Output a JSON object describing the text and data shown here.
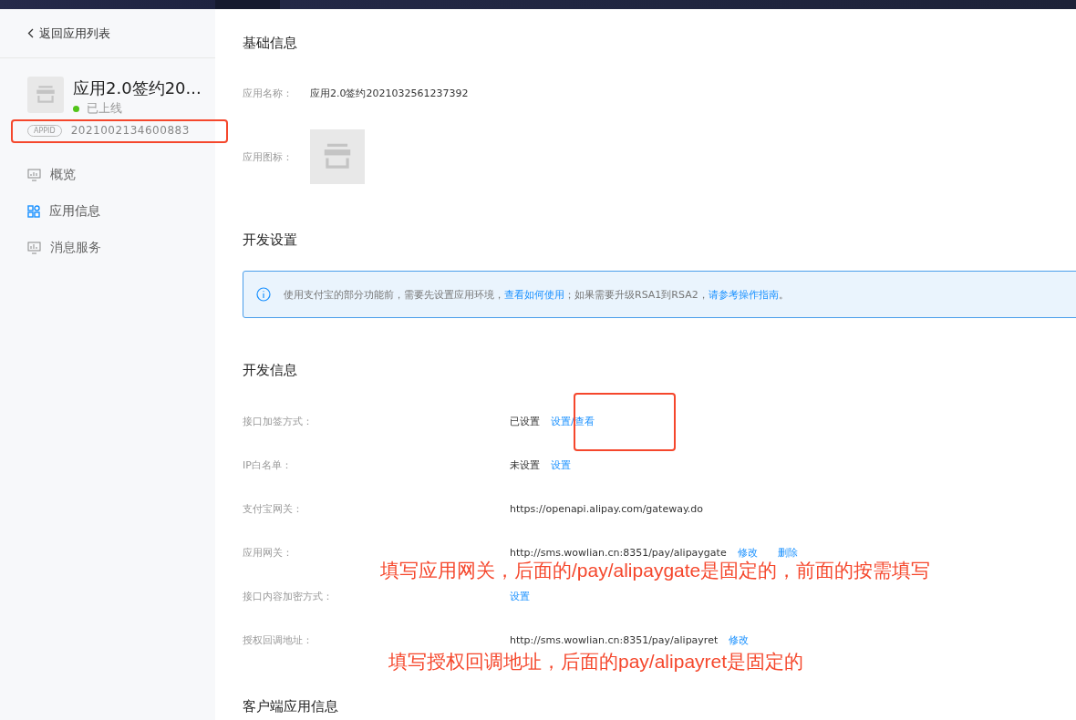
{
  "sidebar": {
    "back_link": "返回应用列表",
    "app": {
      "name": "应用2.0签约20...",
      "status": "已上线",
      "color": "#52c41a",
      "appid_tag": "APPID",
      "appid": "2021002134600883"
    },
    "items": [
      {
        "label": "概览",
        "selected": false,
        "kind": "monitor"
      },
      {
        "label": "应用信息",
        "selected": true,
        "kind": "grid"
      },
      {
        "label": "消息服务",
        "selected": false,
        "kind": "chart"
      }
    ]
  },
  "basic_info": {
    "title": "基础信息",
    "name_label": "应用名称：",
    "name_value": "应用2.0签约2021032561237392",
    "icon_label": "应用图标："
  },
  "dev_settings": {
    "title": "开发设置",
    "notice": [
      {
        "text": "使用支付宝的部分功能前，需要先设置应用环境，",
        "link": false
      },
      {
        "text": "查看如何使用",
        "link": true
      },
      {
        "text": "；如果需要升级RSA1到RSA2，",
        "link": false
      },
      {
        "text": "请参考操作指南",
        "link": true
      },
      {
        "text": "。",
        "link": false
      }
    ]
  },
  "dev_info": {
    "title": "开发信息",
    "rows": [
      {
        "label": "接口加签方式：",
        "value": "已设置",
        "links": [
          "设置/查看"
        ]
      },
      {
        "label": "IP白名单：",
        "value": "未设置",
        "links": [
          "设置"
        ]
      },
      {
        "label": "支付宝网关：",
        "value": "https://openapi.alipay.com/gateway.do",
        "links": []
      },
      {
        "label": "应用网关：",
        "value": "http://sms.wowlian.cn:8351/pay/alipaygate",
        "links": [
          "修改",
          "删除"
        ]
      },
      {
        "label": "接口内容加密方式：",
        "links": [
          "设置"
        ]
      },
      {
        "label": "授权回调地址：",
        "value": "http://sms.wowlian.cn:8351/pay/alipayret",
        "links": [
          "修改"
        ]
      }
    ]
  },
  "client_info": {
    "title": "客户端应用信息"
  },
  "annotations": [
    {
      "kind": "box"
    },
    {
      "kind": "box"
    },
    {
      "kind": "note",
      "text": "填写应用网关，后面的/pay/alipaygate是固定的，前面的按需填写"
    },
    {
      "kind": "note",
      "text": "填写授权回调地址，后面的pay/alipayret是固定的"
    }
  ]
}
